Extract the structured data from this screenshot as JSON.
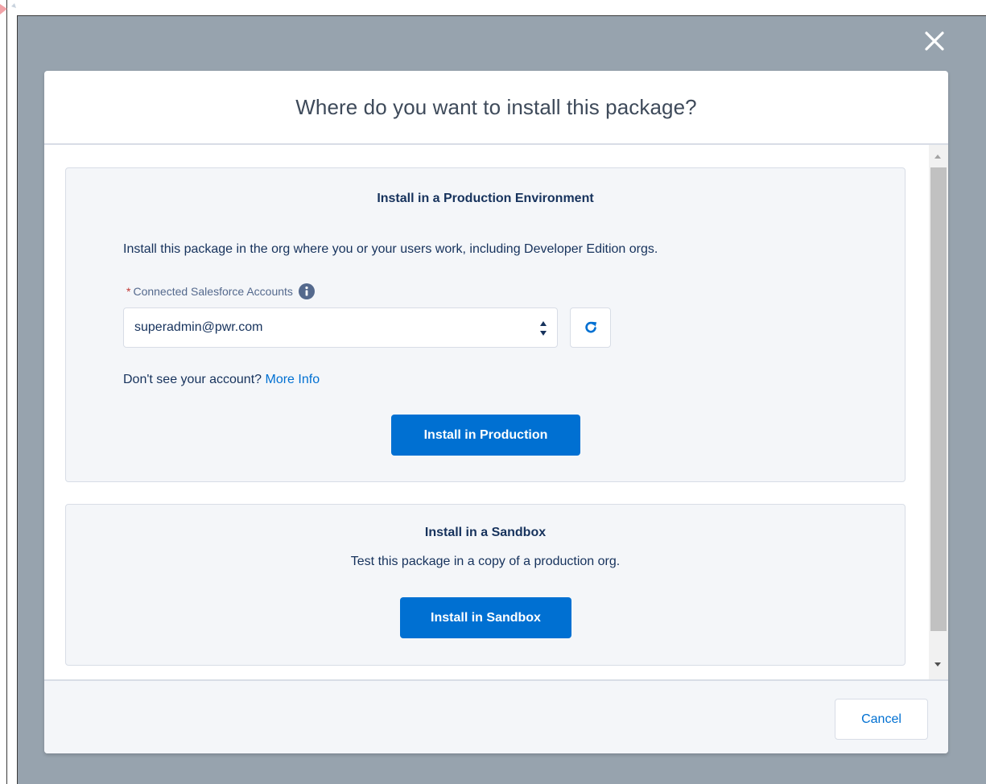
{
  "modal": {
    "title": "Where do you want to install this package?",
    "close_icon": "close-icon"
  },
  "production": {
    "heading": "Install in a Production Environment",
    "description": "Install this package in the org where you or your users work, including Developer Edition orgs.",
    "field_required_marker": "*",
    "field_label": "Connected Salesforce Accounts",
    "field_info_icon": "info-icon",
    "selected_account": "superadmin@pwr.com",
    "refresh_icon": "refresh-icon",
    "help_text": "Don't see your account?",
    "help_link": "More Info",
    "install_button": "Install in Production"
  },
  "sandbox": {
    "heading": "Install in a Sandbox",
    "description": "Test this package in a copy of a production org.",
    "install_button": "Install in Sandbox"
  },
  "footer": {
    "cancel_button": "Cancel"
  },
  "colors": {
    "brand": "#0070d2",
    "backdrop": "#97a3ae",
    "card_background": "#f4f6f9",
    "text": "#16325c",
    "required": "#c23934"
  }
}
